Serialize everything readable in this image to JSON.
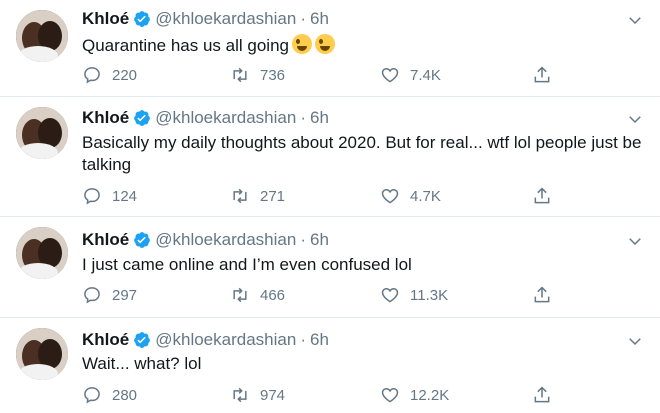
{
  "colors": {
    "text": "#14171a",
    "muted": "#657786",
    "verified": "#1da1f2",
    "divider": "#e1e8ed"
  },
  "icons": {
    "reply": "reply-icon",
    "retweet": "retweet-icon",
    "like": "heart-icon",
    "share": "share-icon",
    "menu": "chevron-down-icon",
    "verified": "verified-badge-icon"
  },
  "tweets": [
    {
      "name": "Khloé",
      "handle": "@khloekardashian",
      "separator": "·",
      "time": "6h",
      "text": "Quarantine has us all going",
      "emoji": "zany-face-emoji x2",
      "replies": "220",
      "retweets": "736",
      "likes": "7.4K"
    },
    {
      "name": "Khloé",
      "handle": "@khloekardashian",
      "separator": "·",
      "time": "6h",
      "text": "Basically my daily thoughts about 2020. But for real... wtf lol people just be talking",
      "replies": "124",
      "retweets": "271",
      "likes": "4.7K"
    },
    {
      "name": "Khloé",
      "handle": "@khloekardashian",
      "separator": "·",
      "time": "6h",
      "text": "I just came online and I’m even confused lol",
      "replies": "297",
      "retweets": "466",
      "likes": "11.3K"
    },
    {
      "name": "Khloé",
      "handle": "@khloekardashian",
      "separator": "·",
      "time": "6h",
      "text": "Wait... what? lol",
      "replies": "280",
      "retweets": "974",
      "likes": "12.2K"
    }
  ]
}
